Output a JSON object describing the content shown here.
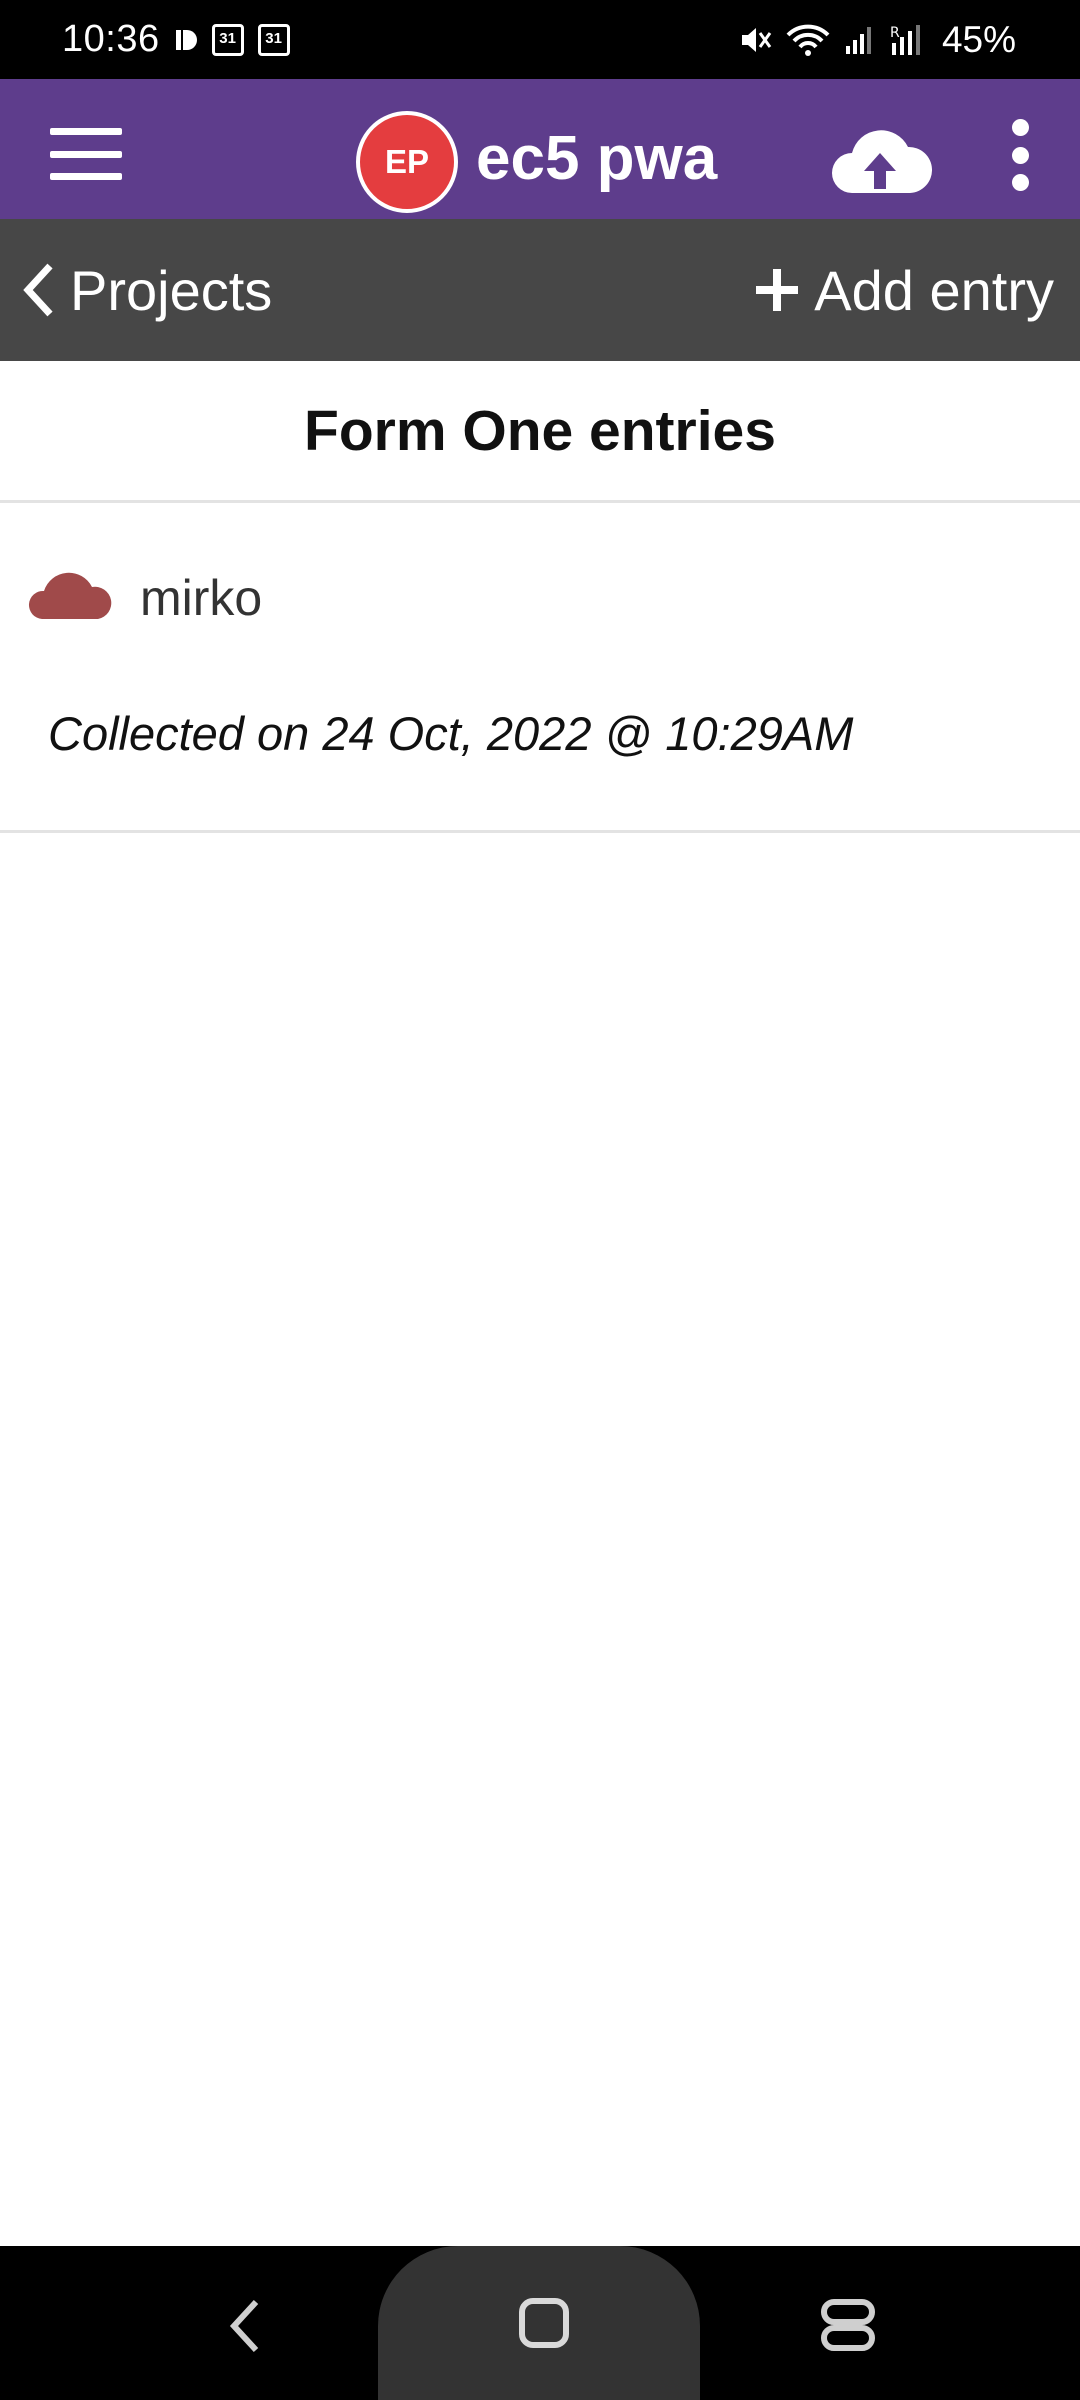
{
  "status_bar": {
    "time": "10:36",
    "calendar_day_1": "31",
    "calendar_day_2": "31",
    "battery": "45%"
  },
  "app_bar": {
    "logo_text": "EP",
    "title": "ec5 pwa",
    "brand_color": "#5e3d8c",
    "logo_color": "#e43d3f"
  },
  "sub_nav": {
    "back_label": "Projects",
    "add_label": "Add entry"
  },
  "page": {
    "title": "Form One entries"
  },
  "entries": [
    {
      "name": "mirko",
      "date": "Collected on 24 Oct, 2022 @ 10:29AM",
      "sync_icon": "cloud-icon",
      "sync_color": "#a04a4a"
    }
  ]
}
